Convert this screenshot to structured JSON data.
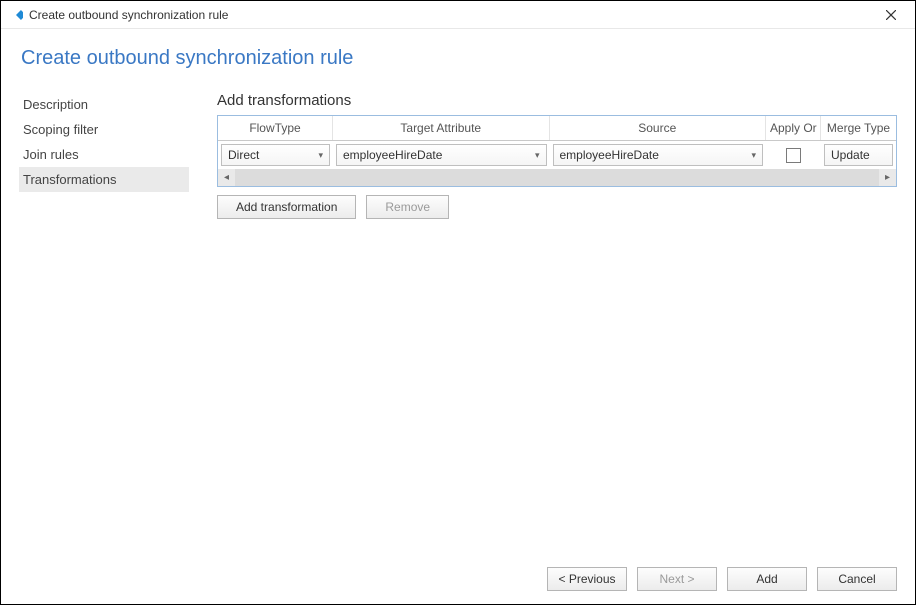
{
  "window": {
    "title": "Create outbound synchronization rule"
  },
  "page": {
    "title": "Create outbound synchronization rule"
  },
  "sidebar": {
    "items": [
      {
        "label": "Description",
        "active": false
      },
      {
        "label": "Scoping filter",
        "active": false
      },
      {
        "label": "Join rules",
        "active": false
      },
      {
        "label": "Transformations",
        "active": true
      }
    ]
  },
  "section": {
    "title": "Add transformations"
  },
  "grid": {
    "headers": {
      "flowtype": "FlowType",
      "target": "Target Attribute",
      "source": "Source",
      "apply": "Apply Or",
      "merge": "Merge Type"
    },
    "rows": [
      {
        "flowtype": "Direct",
        "target": "employeeHireDate",
        "source": "employeeHireDate",
        "apply_once": false,
        "merge": "Update"
      }
    ]
  },
  "buttons": {
    "add_transformation": "Add transformation",
    "remove": "Remove",
    "previous": "< Previous",
    "next": "Next >",
    "add": "Add",
    "cancel": "Cancel"
  }
}
